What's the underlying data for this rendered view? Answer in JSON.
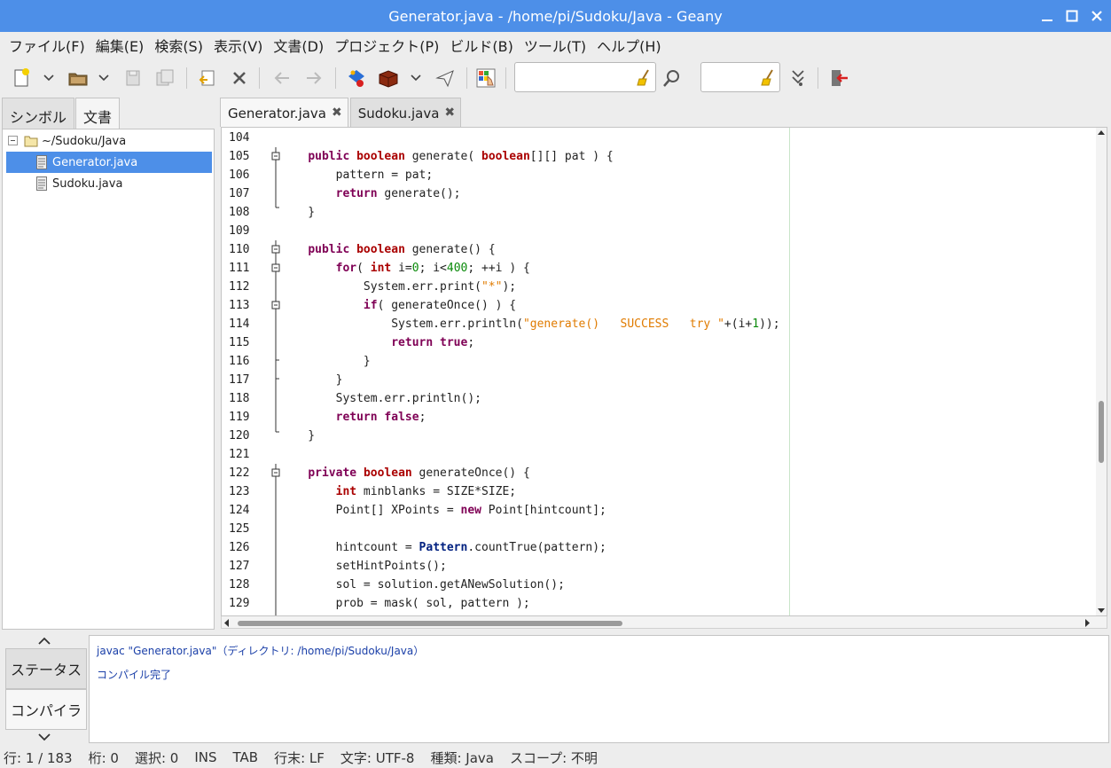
{
  "window": {
    "title": "Generator.java - /home/pi/Sudoku/Java - Geany"
  },
  "menu": [
    "ファイル(F)",
    "編集(E)",
    "検索(S)",
    "表示(V)",
    "文書(D)",
    "プロジェクト(P)",
    "ビルド(B)",
    "ツール(T)",
    "ヘルプ(H)"
  ],
  "sidebar": {
    "tabs": [
      "シンボル",
      "文書"
    ],
    "tree": {
      "folder": "~/Sudoku/Java",
      "files": [
        "Generator.java",
        "Sudoku.java"
      ]
    }
  },
  "editor": {
    "tabs": [
      {
        "label": "Generator.java"
      },
      {
        "label": "Sudoku.java"
      }
    ],
    "line_numbers": [
      "104",
      "105",
      "106",
      "107",
      "108",
      "109",
      "110",
      "111",
      "112",
      "113",
      "114",
      "115",
      "116",
      "117",
      "118",
      "119",
      "120",
      "121",
      "122",
      "123",
      "124",
      "125",
      "126",
      "127",
      "128",
      "129"
    ]
  },
  "messages": {
    "tabs": [
      "ステータス",
      "コンパイラ"
    ],
    "lines": [
      "javac \"Generator.java\"（ディレクトリ: /home/pi/Sudoku/Java）",
      "コンパイル完了"
    ]
  },
  "statusbar": {
    "line": "行: 1 / 183",
    "col": "桁: 0",
    "sel": "選択: 0",
    "mode": "INS",
    "tab": "TAB",
    "eol": "行末: LF",
    "encoding": "文字: UTF-8",
    "filetype": "種類: Java",
    "scope": "スコープ: 不明"
  }
}
